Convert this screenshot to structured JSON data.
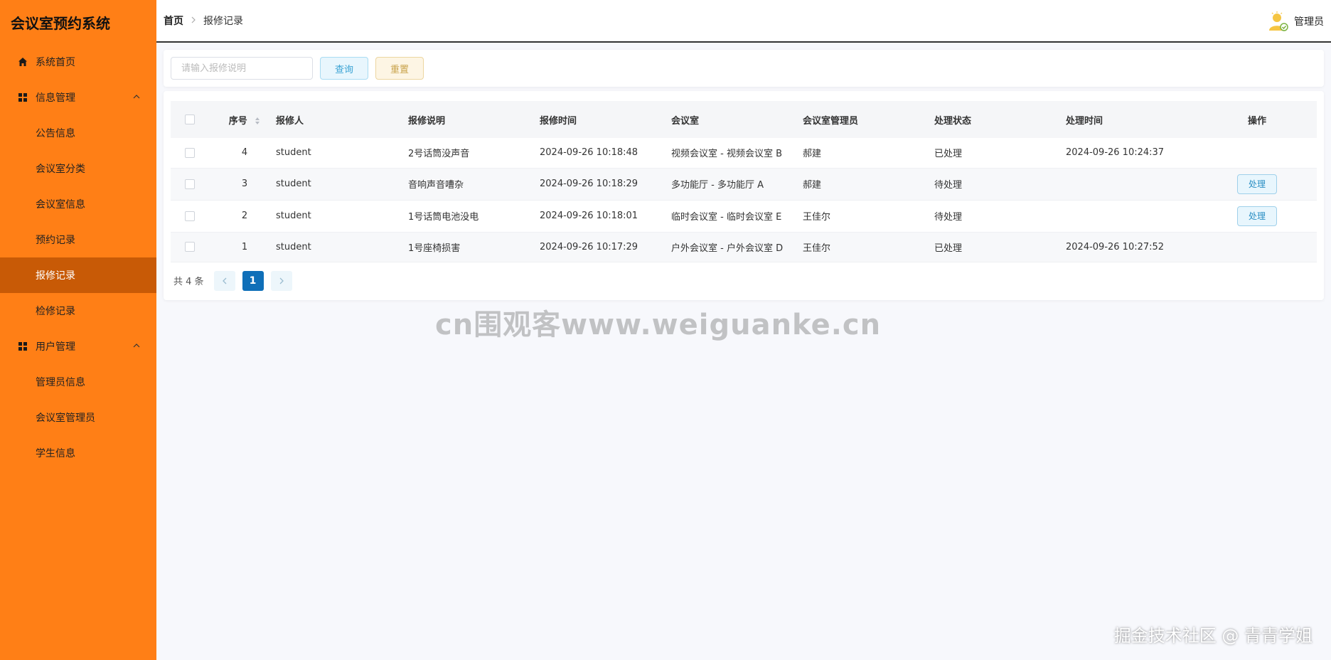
{
  "app": {
    "title": "会议室预约系统"
  },
  "sidebar": {
    "items": [
      {
        "label": "系统首页",
        "icon": "home-icon",
        "type": "top"
      },
      {
        "label": "信息管理",
        "icon": "grid-icon",
        "type": "group"
      },
      {
        "label": "公告信息",
        "type": "sub"
      },
      {
        "label": "会议室分类",
        "type": "sub"
      },
      {
        "label": "会议室信息",
        "type": "sub"
      },
      {
        "label": "预约记录",
        "type": "sub"
      },
      {
        "label": "报修记录",
        "type": "sub",
        "active": true
      },
      {
        "label": "检修记录",
        "type": "sub"
      },
      {
        "label": "用户管理",
        "icon": "grid-icon",
        "type": "group"
      },
      {
        "label": "管理员信息",
        "type": "sub"
      },
      {
        "label": "会议室管理员",
        "type": "sub"
      },
      {
        "label": "学生信息",
        "type": "sub"
      }
    ]
  },
  "header": {
    "breadcrumb": {
      "home": "首页",
      "current": "报修记录"
    },
    "user": {
      "name": "管理员",
      "avatar_icon": "user-avatar-icon"
    }
  },
  "search": {
    "placeholder": "请输入报修说明",
    "value": "",
    "query_label": "查询",
    "reset_label": "重置"
  },
  "table": {
    "columns": [
      "序号",
      "报修人",
      "报修说明",
      "报修时间",
      "会议室",
      "会议室管理员",
      "处理状态",
      "处理时间",
      "操作"
    ],
    "rows": [
      {
        "idx": "4",
        "reporter": "student",
        "desc": "2号话筒没声音",
        "time": "2024-09-26 10:18:48",
        "room": "视频会议室 - 视频会议室 B",
        "manager": "郝建",
        "status": "已处理",
        "ptime": "2024-09-26 10:24:37",
        "action": ""
      },
      {
        "idx": "3",
        "reporter": "student",
        "desc": "音响声音嘈杂",
        "time": "2024-09-26 10:18:29",
        "room": "多功能厅 - 多功能厅 A",
        "manager": "郝建",
        "status": "待处理",
        "ptime": "",
        "action": "处理"
      },
      {
        "idx": "2",
        "reporter": "student",
        "desc": "1号话筒电池没电",
        "time": "2024-09-26 10:18:01",
        "room": "临时会议室 - 临时会议室 E",
        "manager": "王佳尔",
        "status": "待处理",
        "ptime": "",
        "action": "处理"
      },
      {
        "idx": "1",
        "reporter": "student",
        "desc": "1号座椅损害",
        "time": "2024-09-26 10:17:29",
        "room": "户外会议室 - 户外会议室 D",
        "manager": "王佳尔",
        "status": "已处理",
        "ptime": "2024-09-26 10:27:52",
        "action": ""
      }
    ]
  },
  "pagination": {
    "total": "共 4 条",
    "current": "1"
  },
  "watermarks": {
    "center": "cn围观客www.weiguanke.cn",
    "corner": "掘金技术社区 @ 青青学姐"
  },
  "colors": {
    "sidebar": "#ff7f16",
    "active_item": "#c85a06",
    "primary": "#0f6fb8"
  }
}
